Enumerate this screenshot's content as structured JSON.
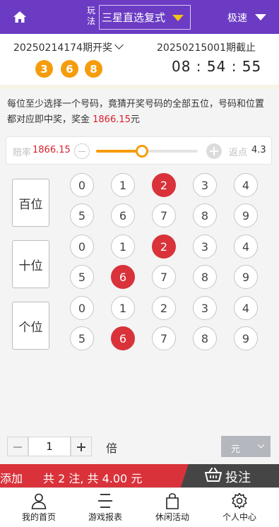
{
  "header": {
    "play_label": "玩法",
    "play_mode": "三星直选复式",
    "speed_label": "极速"
  },
  "draw": {
    "last_period": "20250214174期开奖",
    "last_numbers": [
      "3",
      "6",
      "8"
    ],
    "next_period": "20250215001期截止",
    "countdown": "08 : 54 : 55"
  },
  "rules": {
    "description_prefix": "每位至少选择一个号码，竟猜开奖号码的全部五位，号码和位置都对应即中奖，奖金 ",
    "prize": "1866.15",
    "description_suffix": "元"
  },
  "odds": {
    "odds_label": "赔率",
    "odds_value": "1866.15",
    "rebate_label": "返点",
    "rebate_value": "4.3",
    "slider_fraction": 0.45
  },
  "board": {
    "positions": [
      {
        "label": "百位",
        "numbers": [
          "0",
          "1",
          "2",
          "3",
          "4",
          "5",
          "6",
          "7",
          "8",
          "9"
        ],
        "selected": [
          "2"
        ]
      },
      {
        "label": "十位",
        "numbers": [
          "0",
          "1",
          "2",
          "3",
          "4",
          "5",
          "6",
          "7",
          "8",
          "9"
        ],
        "selected": [
          "2",
          "6"
        ]
      },
      {
        "label": "个位",
        "numbers": [
          "0",
          "1",
          "2",
          "3",
          "4",
          "5",
          "6",
          "7",
          "8",
          "9"
        ],
        "selected": [
          "6"
        ]
      }
    ]
  },
  "multiplier": {
    "value": "1",
    "unit_label": "倍",
    "currency": "元"
  },
  "betbar": {
    "add_label": "添加",
    "summary": "共 2 注, 共 4.00 元",
    "submit_label": "投注"
  },
  "nav": [
    {
      "label": "我的首页",
      "icon": "user-icon"
    },
    {
      "label": "游戏报表",
      "icon": "list-icon"
    },
    {
      "label": "休闲活动",
      "icon": "bag-icon"
    },
    {
      "label": "个人中心",
      "icon": "gear-icon"
    }
  ],
  "colors": {
    "header_bg": "#6b3bc4",
    "accent_orange": "#f59c0c",
    "selected_red": "#d9323a",
    "bet_button": "#454545"
  }
}
